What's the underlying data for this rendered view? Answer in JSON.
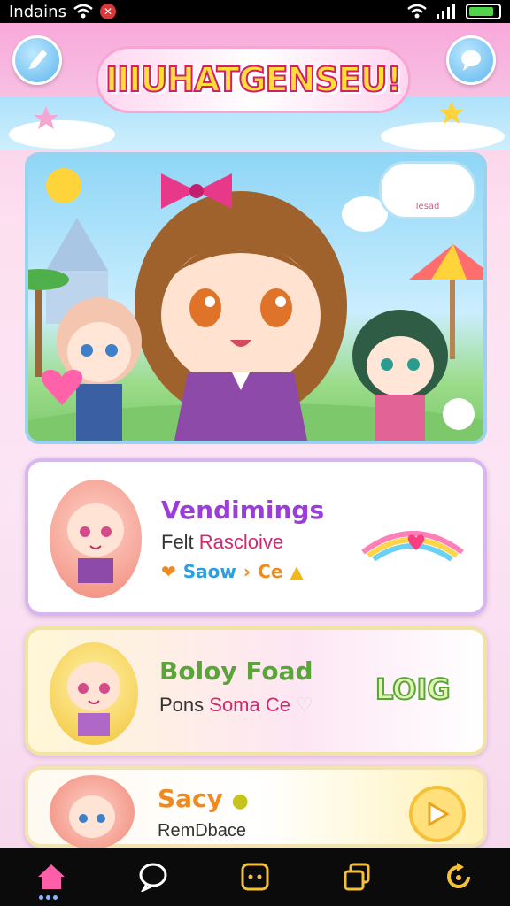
{
  "status_bar": {
    "carrier": "Indains",
    "battery_level": 0.85,
    "icons": [
      "wifi-icon",
      "alert-icon",
      "wifi-icon",
      "signal-icon",
      "battery-icon"
    ]
  },
  "header": {
    "title": "IIIUHATGENSEU!",
    "left_button_icon": "pencil-icon",
    "right_button_icon": "chat-bubble-icon"
  },
  "hero": {
    "speech_label": "Iesad"
  },
  "cards": [
    {
      "title": "Vendimings",
      "subtitle_prefix": "Felt ",
      "subtitle_accent": "Rascloive",
      "tag_blue": "Saow",
      "tag_orange": "Ce",
      "decoration": "rainbow-heart-icon"
    },
    {
      "title": "Boloy Foad",
      "subtitle_prefix": "Pons ",
      "subtitle_accent": "Soma Ce",
      "badge": "LOIG"
    },
    {
      "title": "Sacy",
      "subtitle_prefix": "RemDbace",
      "subtitle_accent": "",
      "action_icon": "play-icon"
    }
  ],
  "bottom_nav": {
    "items": [
      "home-icon",
      "chat-icon",
      "game-icon",
      "cards-icon",
      "refresh-icon"
    ],
    "active": "home-icon"
  },
  "colors": {
    "pink_accent": "#e94fa0",
    "sky": "#8fd6f6",
    "card_border": "#d8b7f0",
    "nav_bg": "#0b0b0b"
  }
}
